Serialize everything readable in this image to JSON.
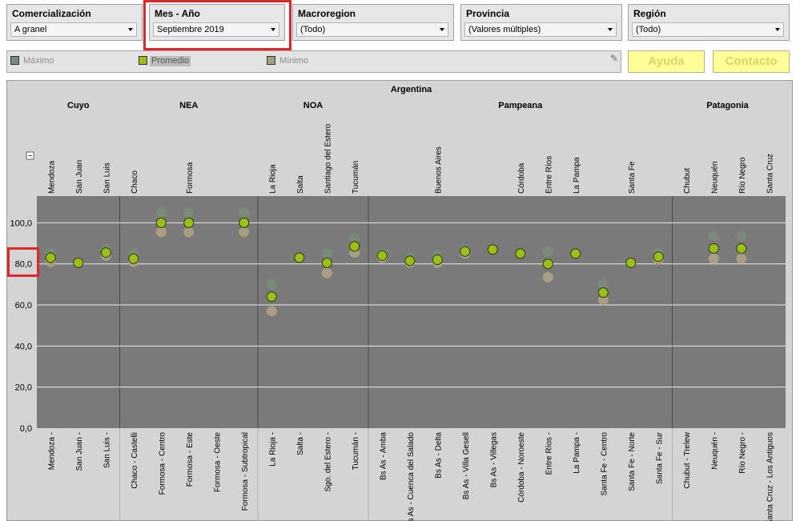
{
  "filters": [
    {
      "title": "Comercialización",
      "value": "A granel"
    },
    {
      "title": "Mes - Año",
      "value": "Septiembre 2019"
    },
    {
      "title": "Macroregion",
      "value": "(Todo)"
    },
    {
      "title": "Provincia",
      "value": "(Valores múltiples)"
    },
    {
      "title": "Región",
      "value": "(Todo)"
    }
  ],
  "legend": [
    {
      "label": "Máximo",
      "color": "#7a8a7a"
    },
    {
      "label": "Promedio",
      "color": "#9bbf1a"
    },
    {
      "label": "Mínimo",
      "color": "#a89e83"
    }
  ],
  "legend_icon": "pen-icon",
  "buttons": {
    "help": "Ayuda",
    "contact": "Contacto"
  },
  "colors": {
    "plot_bg": "#7a7a7a",
    "panel_bg": "#d4d4d4",
    "highlight": "#e0262b",
    "button_bg": "#ffff99"
  },
  "chart_data": {
    "type": "scatter",
    "top_header": "Argentina",
    "regions": [
      "Cuyo",
      "NEA",
      "NOA",
      "Pampeana",
      "Patagonia"
    ],
    "collapse_symbol": "−",
    "yticks": [
      "0,0",
      "20,0",
      "40,0",
      "60,0",
      "80,0",
      "100,0"
    ],
    "ylim": [
      0,
      113
    ],
    "columns": [
      {
        "region": "Cuyo",
        "province": "Mendoza",
        "zone": "Mendoza -",
        "max": 85,
        "avg": 83,
        "min": 81
      },
      {
        "region": "Cuyo",
        "province": "San Juan",
        "zone": "San Juan -",
        "max": null,
        "avg": 80.5,
        "min": null
      },
      {
        "region": "Cuyo",
        "province": "San Luis",
        "zone": "San Luis -",
        "max": 87,
        "avg": 85.5,
        "min": 84
      },
      {
        "region": "NEA",
        "province": "Chaco",
        "zone": "Chaco - Castelli",
        "max": 85,
        "avg": 82.5,
        "min": 81
      },
      {
        "region": "NEA",
        "province": "",
        "zone": "Formosa - Centro",
        "max": 105,
        "avg": 100,
        "min": 95.5
      },
      {
        "region": "NEA",
        "province": "Formosa",
        "zone": "Formosa - Este",
        "max": 105,
        "avg": 100,
        "min": 95.5
      },
      {
        "region": "NEA",
        "province": "",
        "zone": "Formosa - Oeste",
        "max": null,
        "avg": null,
        "min": null
      },
      {
        "region": "NEA",
        "province": "",
        "zone": "Formosa - Subtropical",
        "max": 105,
        "avg": 100,
        "min": 95.5
      },
      {
        "region": "NOA",
        "province": "La Rioja",
        "zone": "La Rioja -",
        "max": 70,
        "avg": 64,
        "min": 57
      },
      {
        "region": "NOA",
        "province": "Salta",
        "zone": "Salta -",
        "max": null,
        "avg": 83,
        "min": null
      },
      {
        "region": "NOA",
        "province": "Santiago del Estero",
        "zone": "Sgo. del Estero -",
        "max": 85,
        "avg": 80.5,
        "min": 75.5
      },
      {
        "region": "NOA",
        "province": "Tucumán",
        "zone": "Tucumán -",
        "max": 92.5,
        "avg": 88.5,
        "min": 85.5
      },
      {
        "region": "Pampeana",
        "province": "",
        "zone": "Bs As - Amba",
        "max": 85,
        "avg": 84,
        "min": 83
      },
      {
        "region": "Pampeana",
        "province": "",
        "zone": "Bs As - Cuenca del Salado",
        "max": 83,
        "avg": 81.5,
        "min": 80.5
      },
      {
        "region": "Pampeana",
        "province": "Buenos Aires",
        "zone": "Bs As - Delta",
        "max": 84,
        "avg": 82,
        "min": 80.5
      },
      {
        "region": "Pampeana",
        "province": "",
        "zone": "Bs As - Villa Gesell",
        "max": 87,
        "avg": 86,
        "min": 85
      },
      {
        "region": "Pampeana",
        "province": "",
        "zone": "Bs As - Villegas",
        "max": null,
        "avg": 87,
        "min": null
      },
      {
        "region": "Pampeana",
        "province": "Córdoba",
        "zone": "Córdoba - Noroeste",
        "max": null,
        "avg": 85,
        "min": null
      },
      {
        "region": "Pampeana",
        "province": "Entre Ríos",
        "zone": "Entre Ríos -",
        "max": 86,
        "avg": 80,
        "min": 73.5
      },
      {
        "region": "Pampeana",
        "province": "La Pampa",
        "zone": "La Pampa -",
        "max": null,
        "avg": 85,
        "min": null
      },
      {
        "region": "Pampeana",
        "province": "",
        "zone": "Santa Fe - Centro",
        "max": 70,
        "avg": 66,
        "min": 62.5
      },
      {
        "region": "Pampeana",
        "province": "Santa Fe",
        "zone": "Santa Fe - Norte",
        "max": null,
        "avg": 80.5,
        "min": null
      },
      {
        "region": "Pampeana",
        "province": "",
        "zone": "Santa Fe - Sur",
        "max": 85,
        "avg": 83.5,
        "min": 82
      },
      {
        "region": "Patagonia",
        "province": "Chubut",
        "zone": "Chubut - Trelew",
        "max": null,
        "avg": null,
        "min": null
      },
      {
        "region": "Patagonia",
        "province": "Neuquén",
        "zone": "Neuquén -",
        "max": 93.5,
        "avg": 87.5,
        "min": 82.5
      },
      {
        "region": "Patagonia",
        "province": "Río Negro",
        "zone": "Río Negro -",
        "max": 93.5,
        "avg": 87.5,
        "min": 82.5
      },
      {
        "region": "Patagonia",
        "province": "Santa Cruz",
        "zone": "Santa Cruz - Los Antiguos",
        "max": null,
        "avg": null,
        "min": null
      }
    ]
  }
}
